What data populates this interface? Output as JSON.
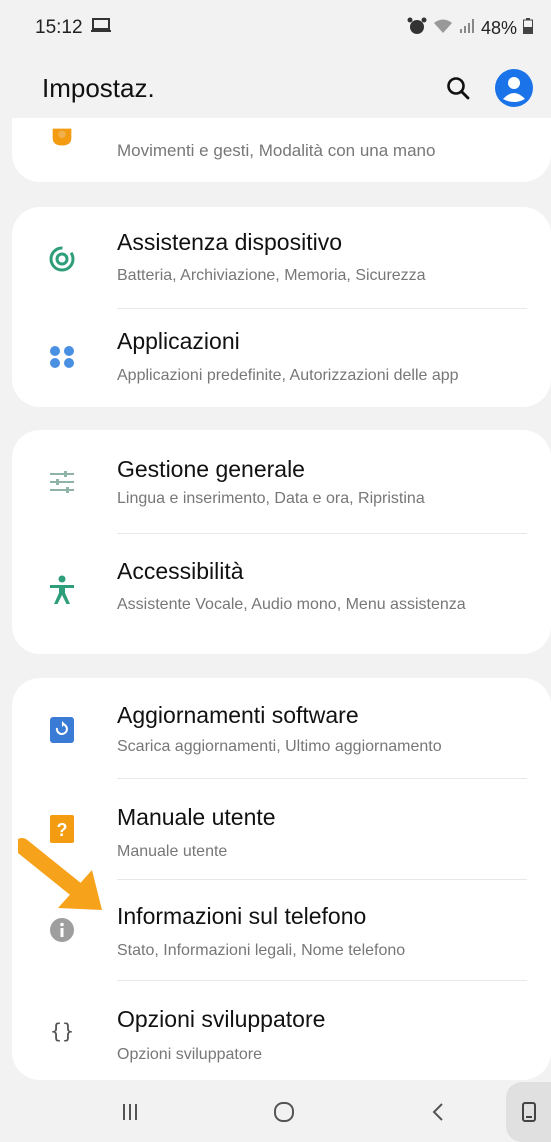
{
  "status_bar": {
    "time": "15:12",
    "battery": "48%"
  },
  "header": {
    "title": "Impostaz."
  },
  "colors": {
    "accent_blue": "#1a73e8",
    "green": "#2e9e7a",
    "orange_annotation": "#f7a21b",
    "help_orange": "#f39c12"
  },
  "items": [
    {
      "title": "",
      "subtitle": "Movimenti e gesti, Modalità con una mano",
      "icon": "puzzle-icon"
    },
    {
      "title": "Assistenza dispositivo",
      "subtitle": "Batteria, Archiviazione, Memoria, Sicurezza",
      "icon": "device-care-icon"
    },
    {
      "title": "Applicazioni",
      "subtitle": "Applicazioni predefinite, Autorizzazioni delle app",
      "icon": "apps-grid-icon"
    },
    {
      "title": "Gestione generale",
      "subtitle": "Lingua e inserimento, Data e ora, Ripristina",
      "icon": "sliders-icon"
    },
    {
      "title": "Accessibilità",
      "subtitle": "Assistente Vocale, Audio mono, Menu assistenza",
      "icon": "accessibility-icon"
    },
    {
      "title": "Aggiornamenti software",
      "subtitle": "Scarica aggiornamenti, Ultimo aggiornamento",
      "icon": "software-update-icon"
    },
    {
      "title": "Manuale utente",
      "subtitle": "Manuale utente",
      "icon": "help-icon"
    },
    {
      "title": "Informazioni sul telefono",
      "subtitle": "Stato, Informazioni legali, Nome telefono",
      "icon": "info-icon"
    },
    {
      "title": "Opzioni sviluppatore",
      "subtitle": "Opzioni sviluppatore",
      "icon": "braces-icon"
    }
  ],
  "nav": {
    "recents": "recents-icon",
    "home": "home-icon",
    "back": "back-icon",
    "rotate": "rotate-icon"
  }
}
